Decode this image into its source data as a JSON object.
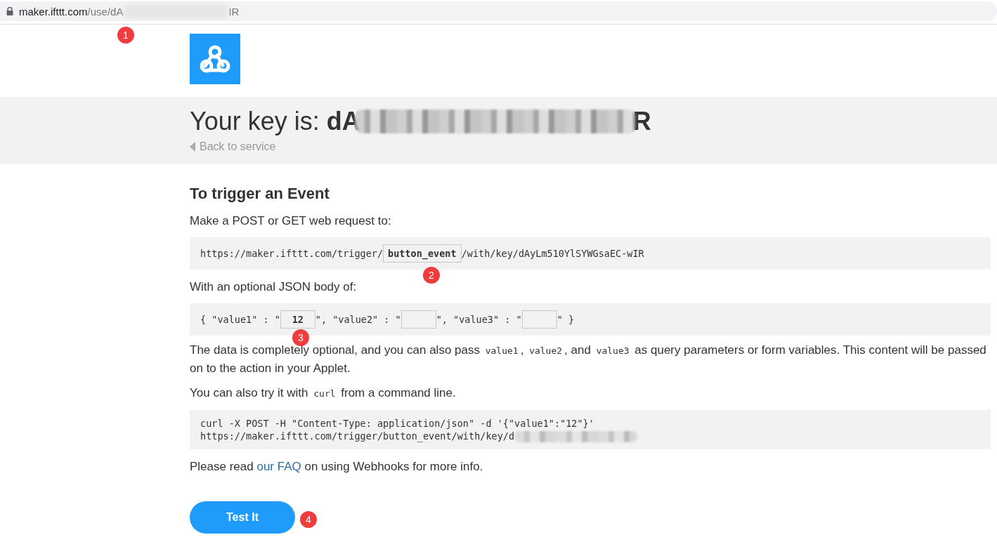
{
  "browser": {
    "address_start": "maker.ifttt.com/use/dA",
    "address_end": "IR"
  },
  "key_band": {
    "label": "Your key is: ",
    "key_start": "dA",
    "key_end": "R",
    "back_link": "Back to service"
  },
  "trigger": {
    "title": "To trigger an Event",
    "request_intro": "Make a POST or GET web request to:",
    "url_prefix": "https://maker.ifttt.com/trigger/",
    "event_name": "button_event",
    "url_suffix": "/with/key/dAyLm510YlSYWGsaEC-wIR",
    "body_intro": "With an optional JSON body of:",
    "body_fields": [
      {
        "label": "{ \"value1\" : \"",
        "value": "12"
      },
      {
        "label": "\", \"value2\" : \""
      },
      {
        "label": "\", \"value3\" : \""
      }
    ],
    "body_end": "\" }",
    "note": [
      {
        "kind": "text",
        "text": "The data is completely optional, and you can also pass "
      },
      {
        "kind": "code",
        "text": "value1"
      },
      {
        "kind": "text",
        "text": ", "
      },
      {
        "kind": "code",
        "text": "value2"
      },
      {
        "kind": "text",
        "text": ", and "
      },
      {
        "kind": "code",
        "text": "value3"
      },
      {
        "kind": "text",
        "text": " as query parameters or form variables. This content will be passed on to the action in your Applet."
      }
    ],
    "curl_intro": [
      {
        "kind": "text",
        "text": "You can also try it with "
      },
      {
        "kind": "code",
        "text": "curl"
      },
      {
        "kind": "text",
        "text": " from a command line."
      }
    ],
    "curl_lines": [
      "curl -X POST -H \"Content-Type: application/json\" -d '{\"value1\":\"12\"}'",
      "https://maker.ifttt.com/trigger/button_event/with/key/d"
    ],
    "faq": {
      "before": "Please read ",
      "link": "our FAQ",
      "after": " on using Webhooks for more info."
    },
    "button": "Test It"
  },
  "annotations": [
    "1",
    "2",
    "3",
    "4"
  ]
}
